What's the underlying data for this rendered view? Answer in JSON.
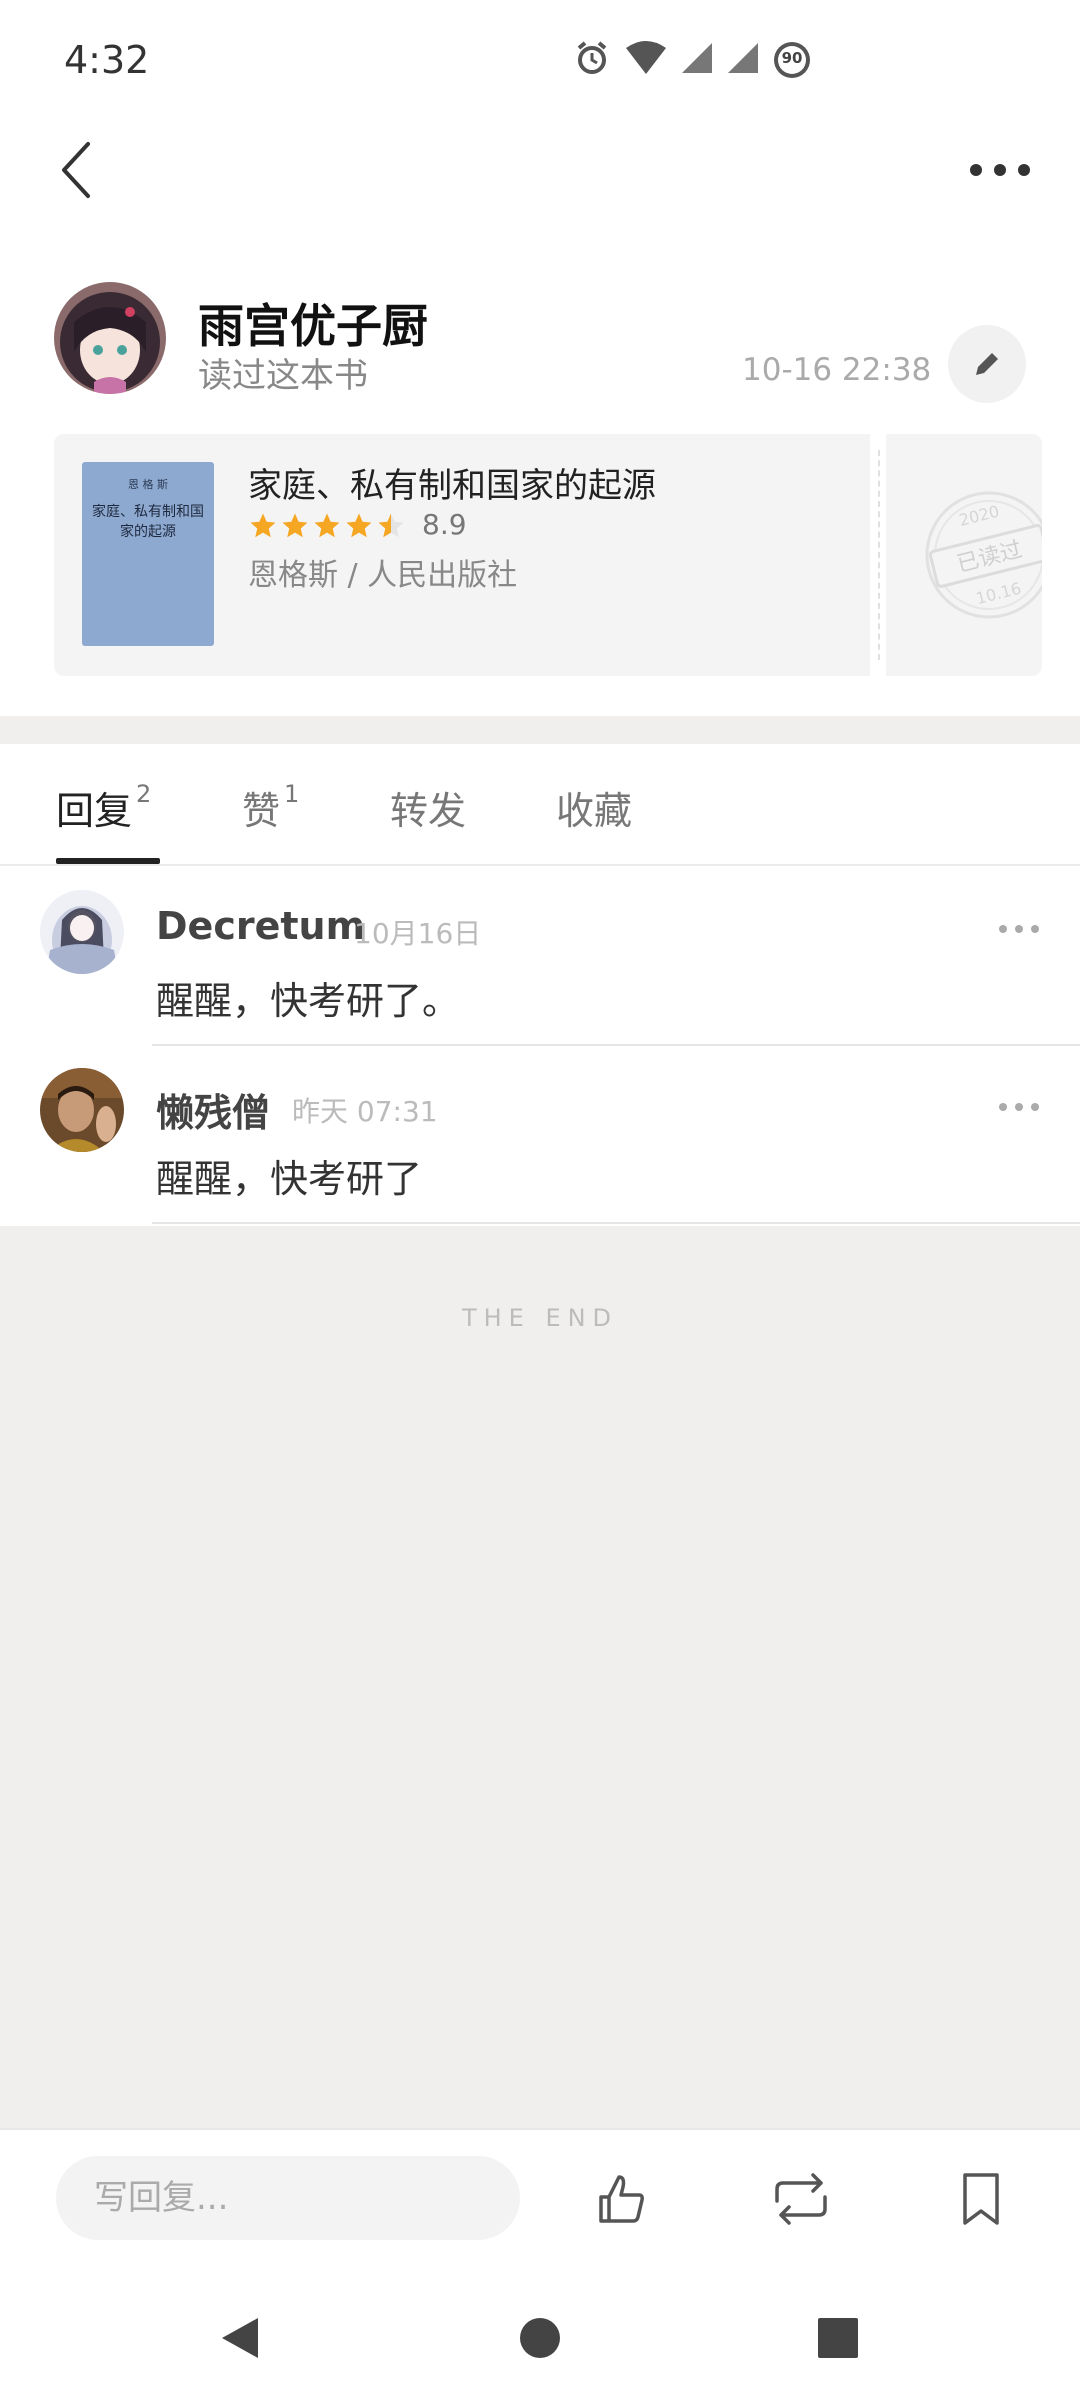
{
  "status_bar": {
    "time": "4:32",
    "battery": "90"
  },
  "top_bar": {
    "back_icon": "chevron-left-icon",
    "more_icon": "more-horizontal-icon"
  },
  "post": {
    "username": "雨宫优子厨",
    "action": "读过这本书",
    "time": "10-16 22:38"
  },
  "book": {
    "title": "家庭、私有制和国家的起源",
    "rating": "8.9",
    "rating_stars": 4.5,
    "meta": "恩格斯 / 人民出版社",
    "cover_author": "恩 格 斯",
    "cover_title": "家庭、私有制和国家的起源",
    "stamp": {
      "year": "2020",
      "label": "已读过",
      "date": "10.16"
    }
  },
  "tabs": [
    {
      "label": "回复",
      "count": "2",
      "active": true
    },
    {
      "label": "赞",
      "count": "1",
      "active": false
    },
    {
      "label": "转发",
      "count": "",
      "active": false
    },
    {
      "label": "收藏",
      "count": "",
      "active": false
    }
  ],
  "comments": [
    {
      "name": "Decretum",
      "time": "10月16日",
      "text": "醒醒，快考研了。"
    },
    {
      "name": "懒残僧",
      "time": "昨天 07:31",
      "text": "醒醒，快考研了"
    }
  ],
  "end_text": "THE END",
  "bottom_bar": {
    "reply_placeholder": "写回复...",
    "like_icon": "thumbs-up-icon",
    "repost_icon": "repost-icon",
    "bookmark_icon": "bookmark-icon"
  },
  "colors": {
    "star": "#f5a623",
    "background_gray": "#f0efed",
    "card_gray": "#f4f4f4"
  }
}
